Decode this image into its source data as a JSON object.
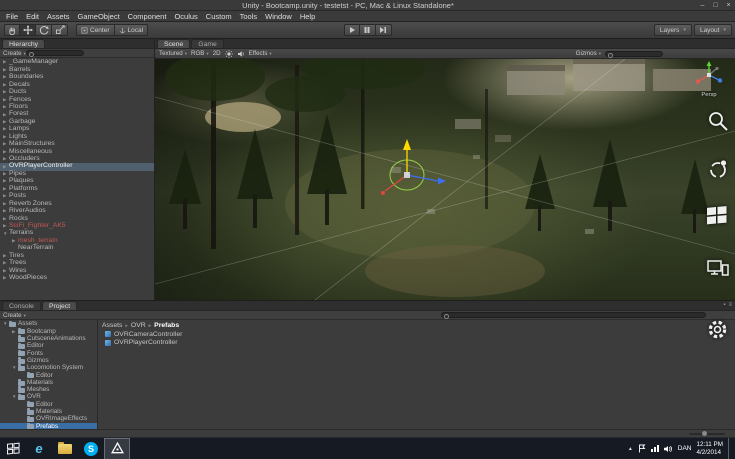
{
  "window": {
    "title": "Unity - Bootcamp.unity - testetst - PC, Mac & Linux Standalone*",
    "minimize": "–",
    "maximize": "□",
    "close": "×"
  },
  "menu": {
    "items": [
      "File",
      "Edit",
      "Assets",
      "GameObject",
      "Component",
      "Oculus",
      "Custom",
      "Tools",
      "Window",
      "Help"
    ]
  },
  "toolbar": {
    "pivot": "Center",
    "rotation": "Local",
    "layers": "Layers",
    "layout": "Layout"
  },
  "hierarchy": {
    "tab": "Hierarchy",
    "create": "Create",
    "search_value": "",
    "items": [
      {
        "label": "_GameManager",
        "arrow": true
      },
      {
        "label": "Barrels",
        "arrow": true
      },
      {
        "label": "Boundaries",
        "arrow": true
      },
      {
        "label": "Decals",
        "arrow": true
      },
      {
        "label": "Ducts",
        "arrow": true
      },
      {
        "label": "Fences",
        "arrow": true
      },
      {
        "label": "Floors",
        "arrow": true
      },
      {
        "label": "Forest",
        "arrow": true
      },
      {
        "label": "Garbage",
        "arrow": true
      },
      {
        "label": "Lamps",
        "arrow": true
      },
      {
        "label": "Lights",
        "arrow": true
      },
      {
        "label": "MainStructures",
        "arrow": true
      },
      {
        "label": "Miscellaneous",
        "arrow": true
      },
      {
        "label": "Occluders",
        "arrow": true
      },
      {
        "label": "OVRPlayerController",
        "arrow": true,
        "selected": true
      },
      {
        "label": "Pipes",
        "arrow": true
      },
      {
        "label": "Plaques",
        "arrow": true
      },
      {
        "label": "Platforms",
        "arrow": true
      },
      {
        "label": "Posts",
        "arrow": true
      },
      {
        "label": "Reverb Zones",
        "arrow": true
      },
      {
        "label": "RiverAudios",
        "arrow": true
      },
      {
        "label": "Rocks",
        "arrow": true
      },
      {
        "label": "SciFi_Fighter_AK5",
        "arrow": true,
        "color": "#c05a55"
      },
      {
        "label": "Terrains",
        "arrow": true,
        "expanded": true
      },
      {
        "label": "mesh_terrain",
        "arrow": true,
        "indent": 1,
        "color": "#c05a55"
      },
      {
        "label": "NearTerrain",
        "arrow": false,
        "indent": 1
      },
      {
        "label": "Tires",
        "arrow": true
      },
      {
        "label": "Trees",
        "arrow": true
      },
      {
        "label": "Wires",
        "arrow": true
      },
      {
        "label": "WoodPieces",
        "arrow": true
      }
    ]
  },
  "scene": {
    "tab_scene": "Scene",
    "tab_game": "Game",
    "shading": "Textured",
    "channels": "RGB",
    "mode_2d": "2D",
    "effects": "Effects",
    "gizmos": "Gizmos",
    "search_value": "",
    "persp": "Persp"
  },
  "bottom": {
    "tab_console": "Console",
    "tab_project": "Project",
    "create": "Create",
    "search_value": "",
    "breadcrumb": [
      "Assets",
      "OVR",
      "Prefabs"
    ],
    "folders": [
      {
        "label": "Assets",
        "arrow": true,
        "expanded": true
      },
      {
        "label": "Bootcamp",
        "arrow": true,
        "indent": 1
      },
      {
        "label": "CutsceneAnimations",
        "arrow": false,
        "indent": 1
      },
      {
        "label": "Editor",
        "arrow": false,
        "indent": 1
      },
      {
        "label": "Fonts",
        "arrow": false,
        "indent": 1
      },
      {
        "label": "Gizmos",
        "arrow": false,
        "indent": 1
      },
      {
        "label": "Locomotion System",
        "arrow": true,
        "expanded": true,
        "indent": 1
      },
      {
        "label": "Editor",
        "arrow": false,
        "indent": 2
      },
      {
        "label": "Materials",
        "arrow": false,
        "indent": 1
      },
      {
        "label": "Meshes",
        "arrow": false,
        "indent": 1
      },
      {
        "label": "OVR",
        "arrow": true,
        "expanded": true,
        "indent": 1
      },
      {
        "label": "Editor",
        "arrow": false,
        "indent": 2
      },
      {
        "label": "Materials",
        "arrow": false,
        "indent": 2
      },
      {
        "label": "OVRImageEffects",
        "arrow": false,
        "indent": 2
      },
      {
        "label": "Prefabs",
        "arrow": false,
        "indent": 2,
        "selected": true
      }
    ],
    "files": [
      {
        "label": "OVRCameraController"
      },
      {
        "label": "OVRPlayerController"
      }
    ]
  },
  "charms": {
    "icons": [
      "search",
      "share",
      "start",
      "devices",
      "settings"
    ]
  },
  "taskbar": {
    "time": "12:11 PM",
    "date": "4/2/2014",
    "lang": "DAN"
  },
  "colors": {
    "hierarchy_selection": "#51606e",
    "project_selection": "#3a6ea5",
    "missing_prefab_text": "#c05a55",
    "prefab_icon": "#3f8fd2",
    "skype_blue": "#00aff0"
  }
}
